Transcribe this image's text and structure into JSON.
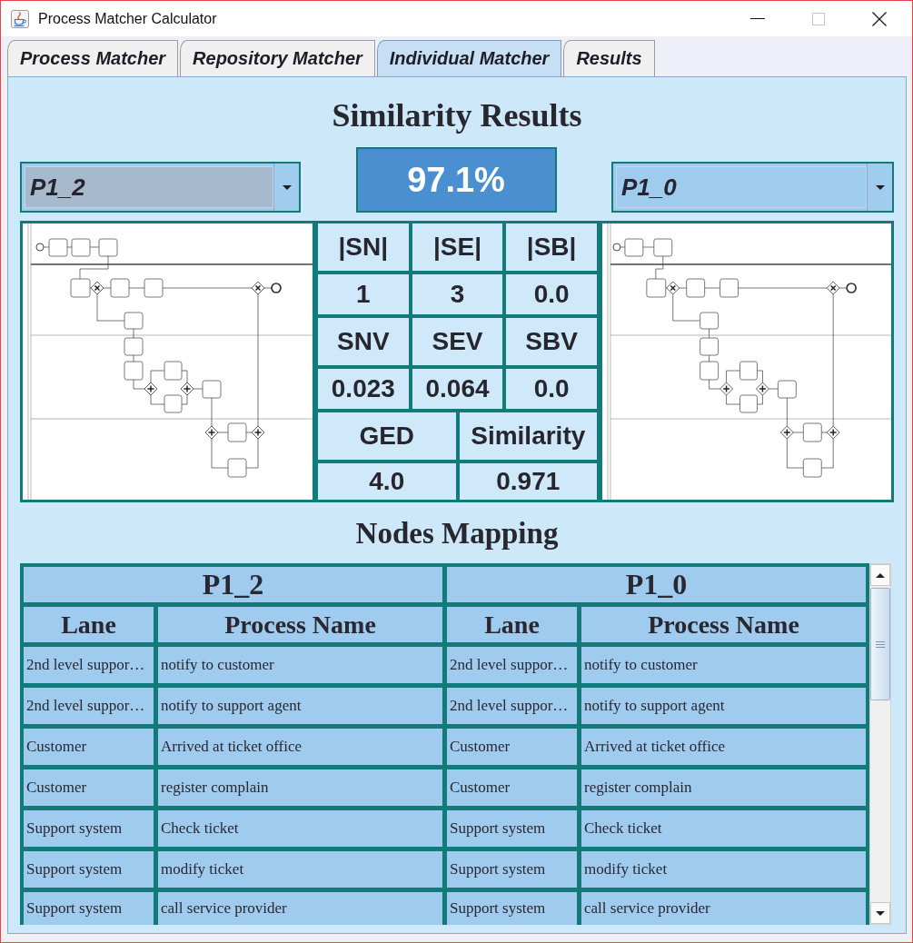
{
  "window": {
    "title": "Process Matcher Calculator",
    "controls": [
      {
        "kind": "minimize",
        "disabled": false
      },
      {
        "kind": "maximize",
        "disabled": true
      },
      {
        "kind": "close",
        "disabled": false
      }
    ]
  },
  "tabs": [
    {
      "label": "Process Matcher",
      "selected": false
    },
    {
      "label": "Repository Matcher",
      "selected": false
    },
    {
      "label": "Individual Matcher",
      "selected": true
    },
    {
      "label": "Results",
      "selected": false
    }
  ],
  "similarity_results": {
    "title": "Similarity Results",
    "process_selectors": [
      {
        "value": "P1_2",
        "focused": true
      },
      {
        "value": "P1_0",
        "focused": false
      }
    ],
    "score": "97.1%",
    "metric_groups": [
      {
        "metrics": [
          {
            "label": "|SN|",
            "value": "1"
          },
          {
            "label": "|SE|",
            "value": "3"
          },
          {
            "label": "|SB|",
            "value": "0.0"
          }
        ]
      },
      {
        "metrics": [
          {
            "label": "SNV",
            "value": "0.023"
          },
          {
            "label": "SEV",
            "value": "0.064"
          },
          {
            "label": "SBV",
            "value": "0.0"
          }
        ]
      },
      {
        "metrics": [
          {
            "label": "GED",
            "value": "4.0"
          },
          {
            "label": "Similarity",
            "value": "0.971"
          }
        ]
      }
    ]
  },
  "nodes_mapping": {
    "title": "Nodes Mapping",
    "groups": [
      {
        "title": "P1_2",
        "columns": [
          "Lane",
          "Process Name"
        ]
      },
      {
        "title": "P1_0",
        "columns": [
          "Lane",
          "Process Name"
        ]
      }
    ],
    "rows": [
      [
        "2nd level suppor…",
        "notify to customer",
        "2nd level suppor…",
        "notify to customer"
      ],
      [
        "2nd level suppor…",
        "notify to support agent",
        "2nd level suppor…",
        "notify to support agent"
      ],
      [
        "Customer",
        "Arrived at ticket office",
        "Customer",
        "Arrived at ticket office"
      ],
      [
        "Customer",
        "register complain",
        "Customer",
        "register complain"
      ],
      [
        "Support system",
        "Check ticket",
        "Support system",
        "Check ticket"
      ],
      [
        "Support system",
        "modify ticket",
        "Support system",
        "modify ticket"
      ],
      [
        "Support system",
        "call service provider",
        "Support system",
        "call service provider"
      ]
    ]
  }
}
